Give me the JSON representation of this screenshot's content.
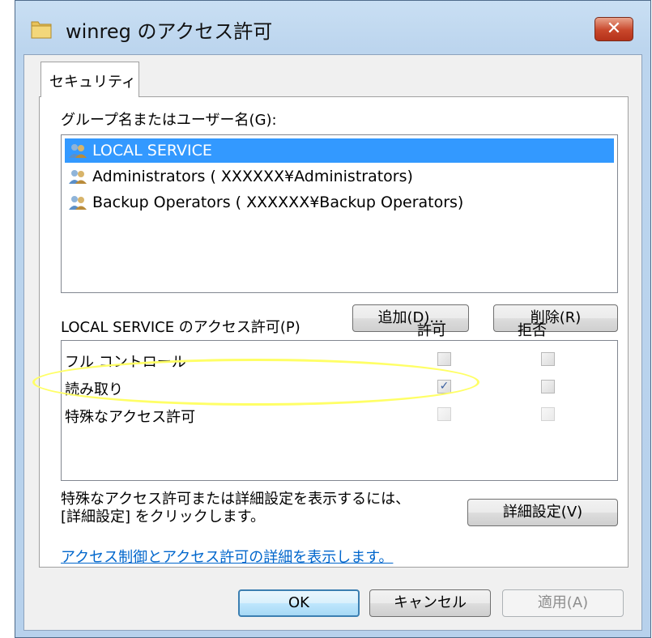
{
  "window": {
    "title": "winreg のアクセス許可",
    "close_label": "✕"
  },
  "tab": {
    "label": "セキュリティ"
  },
  "group_section": {
    "label": "グループ名またはユーザー名(G):",
    "items": [
      {
        "name": "LOCAL SERVICE",
        "selected": true
      },
      {
        "name": "Administrators ( XXXXXX¥Administrators)",
        "selected": false
      },
      {
        "name": "Backup Operators ( XXXXXX¥Backup Operators)",
        "selected": false
      }
    ],
    "add_button": "追加(D)...",
    "remove_button": "削除(R)"
  },
  "permissions": {
    "label": "LOCAL SERVICE のアクセス許可(P)",
    "allow_header": "許可",
    "deny_header": "拒否",
    "rows": [
      {
        "name": "フル コントロール",
        "allow": false,
        "deny": false
      },
      {
        "name": "読み取り",
        "allow": true,
        "deny": false
      },
      {
        "name": "特殊なアクセス許可",
        "allow": false,
        "deny": false
      }
    ]
  },
  "advanced": {
    "text_line1": "特殊なアクセス許可または詳細設定を表示するには、",
    "text_line2": "[詳細設定] をクリックします。",
    "button": "詳細設定(V)"
  },
  "link_text": "アクセス制御とアクセス許可の詳細を表示します。",
  "footer": {
    "ok": "OK",
    "cancel": "キャンセル",
    "apply": "適用(A)"
  },
  "colors": {
    "selection": "#3399ff",
    "highlight_ellipse": "#ffff66",
    "link": "#0066cc"
  }
}
